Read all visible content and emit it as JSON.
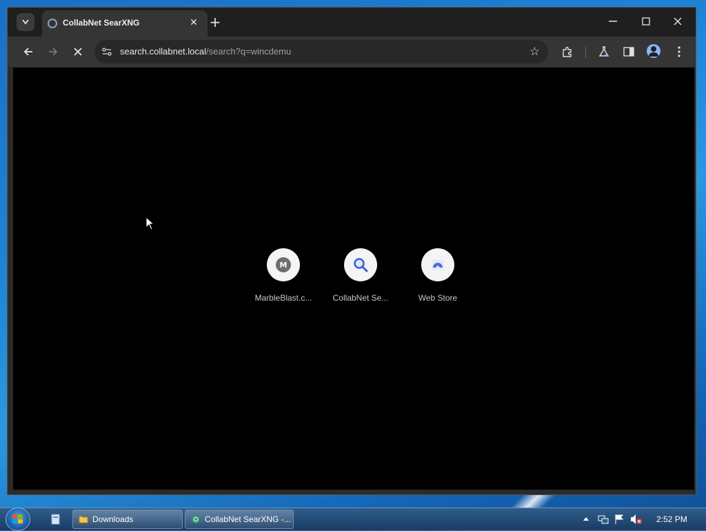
{
  "browser": {
    "tab": {
      "title": "CollabNet SearXNG",
      "close": "✕"
    },
    "new_tab": "+",
    "window_controls": {
      "minimize": "—",
      "maximize": "☐",
      "close": "✕"
    },
    "address": {
      "host": "search.collabnet.local",
      "path": "/search?q=wincdemu"
    },
    "loading": true
  },
  "shortcuts": [
    {
      "label": "MarbleBlast.c...",
      "icon": "M"
    },
    {
      "label": "CollabNet Se...",
      "icon": "search-icon"
    },
    {
      "label": "Web Store",
      "icon": "web-store-icon"
    }
  ],
  "taskbar": {
    "tasks": [
      {
        "label": "Downloads",
        "icon": "folder-icon"
      },
      {
        "label": "CollabNet SearXNG -...",
        "icon": "chrome-icon"
      }
    ],
    "clock": "2:52 PM"
  },
  "colors": {
    "content_bg": "#000000",
    "toolbar_bg": "#353535",
    "tabstrip_bg": "#1f1f1f"
  }
}
